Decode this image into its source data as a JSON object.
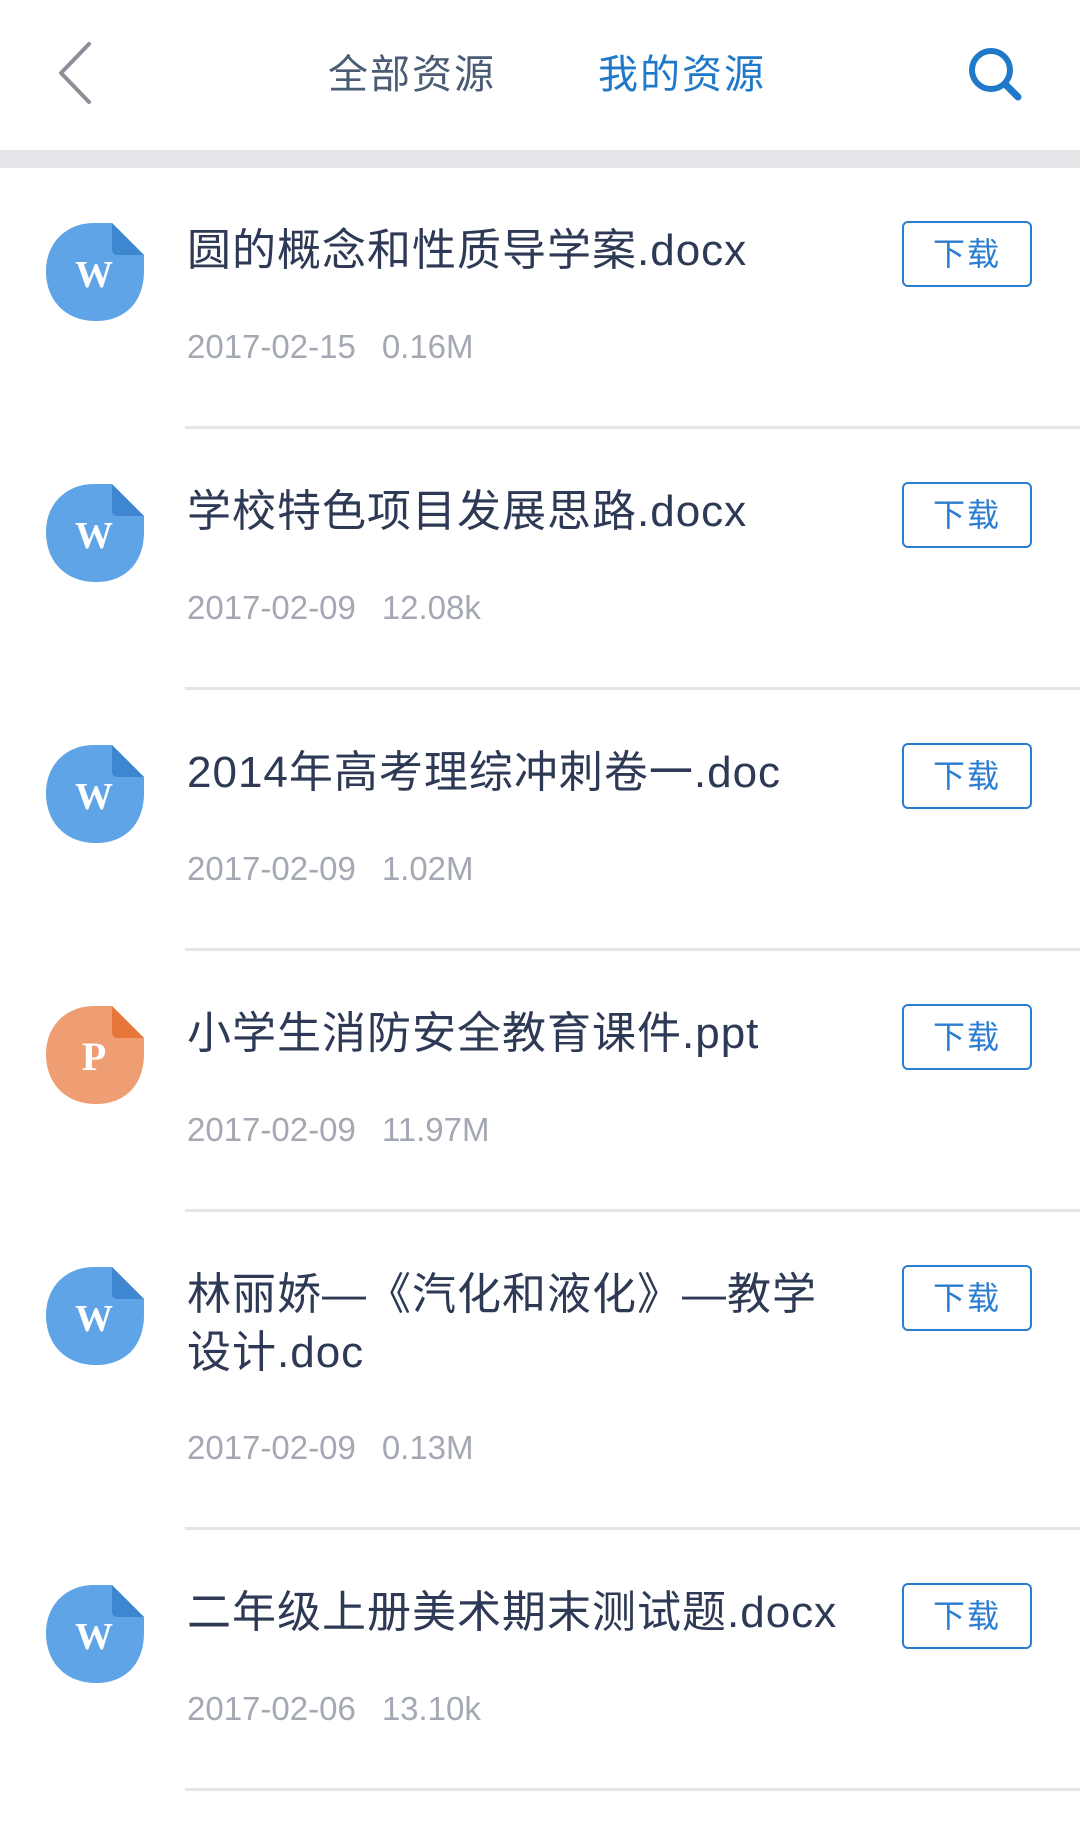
{
  "header": {
    "back_icon": "chevron-left-icon",
    "tabs": [
      {
        "label": "全部资源",
        "active": false
      },
      {
        "label": "我的资源",
        "active": true
      }
    ],
    "search_icon": "search-icon",
    "active_color": "#1f78c8",
    "inactive_color": "#4a5b74"
  },
  "files": [
    {
      "type": "W",
      "icon": "word-file-icon",
      "color": "#5fa4e6",
      "title": "圆的概念和性质导学案.docx",
      "date": "2017-02-15",
      "size": "0.16M",
      "button": "下载"
    },
    {
      "type": "W",
      "icon": "word-file-icon",
      "color": "#5fa4e6",
      "title": "学校特色项目发展思路.docx",
      "date": "2017-02-09",
      "size": "12.08k",
      "button": "下载"
    },
    {
      "type": "W",
      "icon": "word-file-icon",
      "color": "#5fa4e6",
      "title": "2014年高考理综冲刺卷一.doc",
      "date": "2017-02-09",
      "size": "1.02M",
      "button": "下载"
    },
    {
      "type": "P",
      "icon": "ppt-file-icon",
      "color": "#ee9e72",
      "title": "小学生消防安全教育课件.ppt",
      "date": "2017-02-09",
      "size": "11.97M",
      "button": "下载"
    },
    {
      "type": "W",
      "icon": "word-file-icon",
      "color": "#5fa4e6",
      "title": "林丽娇—《汽化和液化》—教学设计.doc",
      "date": "2017-02-09",
      "size": "0.13M",
      "button": "下载"
    },
    {
      "type": "W",
      "icon": "word-file-icon",
      "color": "#5fa4e6",
      "title": "二年级上册美术期末测试题.docx",
      "date": "2017-02-06",
      "size": "13.10k",
      "button": "下载"
    }
  ]
}
